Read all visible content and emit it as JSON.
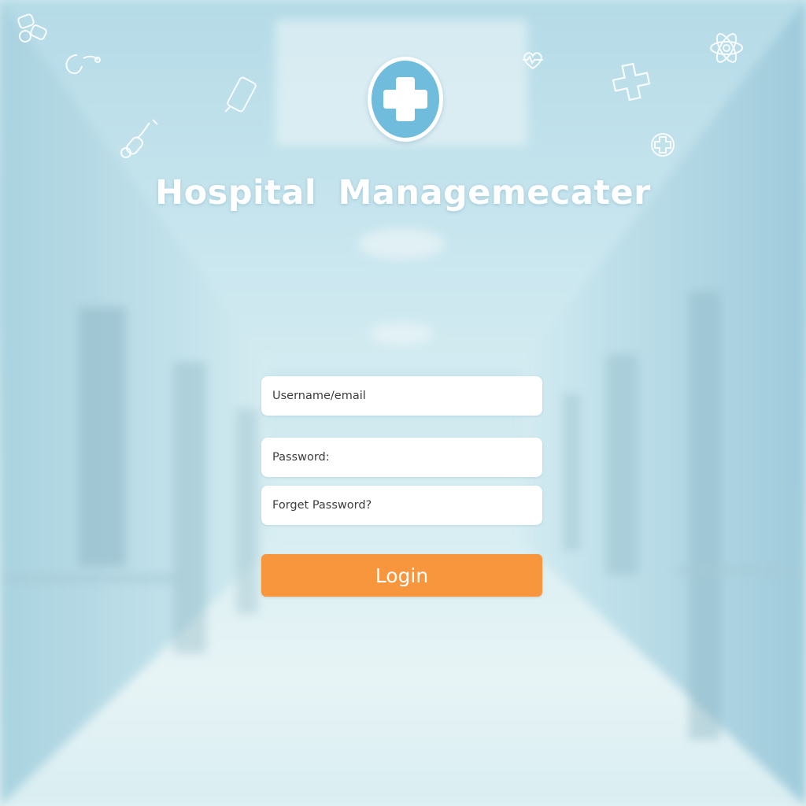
{
  "header": {
    "title": "Hospital Managemecater",
    "logo_icon": "medical-cross-icon"
  },
  "form": {
    "username_placeholder": "Username/email",
    "password_placeholder": "Password:",
    "forgot_password_label": "Forget Password?",
    "login_label": "Login"
  },
  "decorative_icons": [
    "pills-icon",
    "stethoscope-icon",
    "phone-icon",
    "syringe-icon",
    "heart-icon",
    "plus-outline-icon",
    "atom-icon",
    "cross-outline-icon"
  ],
  "colors": {
    "accent": "#f7963d",
    "logo_blue": "#6fbcdc",
    "background": "#c2e2ec"
  }
}
